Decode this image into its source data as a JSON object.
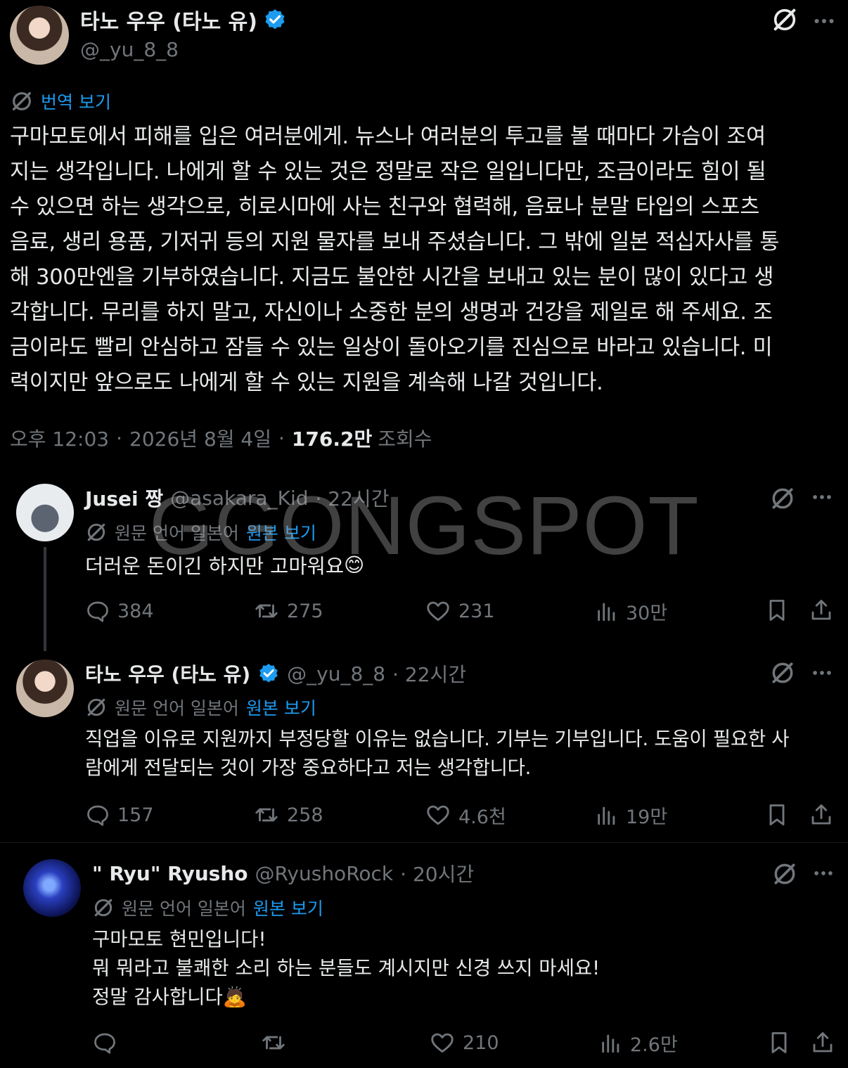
{
  "main_tweet": {
    "display_name": "타노 우우 (타노 유)",
    "handle": "@_yu_8_8",
    "translate_label": "번역 보기",
    "text": "구마모토에서 피해를 입은 여러분에게. 뉴스나 여러분의 투고를 볼 때마다 가슴이 조여\n지는 생각입니다. 나에게 할 수 있는 것은 정말로 작은 일입니다만, 조금이라도 힘이 될\n수 있으면 하는 생각으로, 히로시마에 사는 친구와 협력해, 음료나 분말 타입의 스포츠\n음료, 생리 용품, 기저귀 등의 지원 물자를 보내 주셨습니다. 그 밖에 일본 적십자사를 통\n해 300만엔을 기부하였습니다. 지금도 불안한 시간을 보내고 있는 분이 많이 있다고 생\n각합니다. 무리를 하지 말고, 자신이나 소중한 분의 생명과 건강을 제일로 해 주세요. 조\n금이라도 빨리 안심하고 잠들 수 있는 일상이 돌아오기를 진심으로 바라고 있습니다. 미\n력이지만 앞으로도 나에게 할 수 있는 지원을 계속해 나갈 것입니다.",
    "time": "오후 12:03",
    "date": "2026년 8월 4일",
    "views_count": "176.2만",
    "views_label": "조회수",
    "sep": "·"
  },
  "replies": [
    {
      "display_name": "Jusei 짱",
      "handle": "@asakara_Kid",
      "age": "· 22시간",
      "lang_note": "원문 언어 일본어",
      "original_link": "원본 보기",
      "text": "더러운 돈이긴 하지만 고마워요",
      "emoji": "😊",
      "replies": "384",
      "retweets": "275",
      "likes": "231",
      "views": "30만"
    },
    {
      "display_name": "타노 우우 (타노 유)",
      "handle": "@_yu_8_8",
      "age": "· 22시간",
      "lang_note": "원문 언어 일본어",
      "original_link": "원본 보기",
      "text": "직업을 이유로 지원까지 부정당할 이유는 없습니다. 기부는 기부입니다. 도움이 필요한 사\n람에게 전달되는 것이 가장 중요하다고 저는 생각합니다.",
      "replies": "157",
      "retweets": "258",
      "likes": "4.6천",
      "views": "19만"
    },
    {
      "display_name": "\" Ryu\" Ryusho",
      "handle": "@RyushoRock",
      "age": "· 20시간",
      "lang_note": "원문 언어 일본어",
      "original_link": "원본 보기",
      "text": "구마모토 현민입니다!\n뭐 뭐라고 불쾌한 소리 하는 분들도 계시지만 신경 쓰지 마세요!\n정말 감사합니다",
      "emoji": "🙇",
      "replies": "",
      "retweets": "",
      "likes": "210",
      "views": "2.6만"
    }
  ],
  "watermark": "GGONGSPOT",
  "icons": [
    "grok-icon",
    "more-icon",
    "translate-icon",
    "reply-icon",
    "retweet-icon",
    "like-icon",
    "views-icon",
    "bookmark-icon",
    "share-icon",
    "verified-badge"
  ],
  "colors": {
    "background": "#000000",
    "text": "#e7e9ea",
    "muted": "#71767b",
    "link": "#1d9bf0",
    "verified": "#1d9bf0"
  }
}
